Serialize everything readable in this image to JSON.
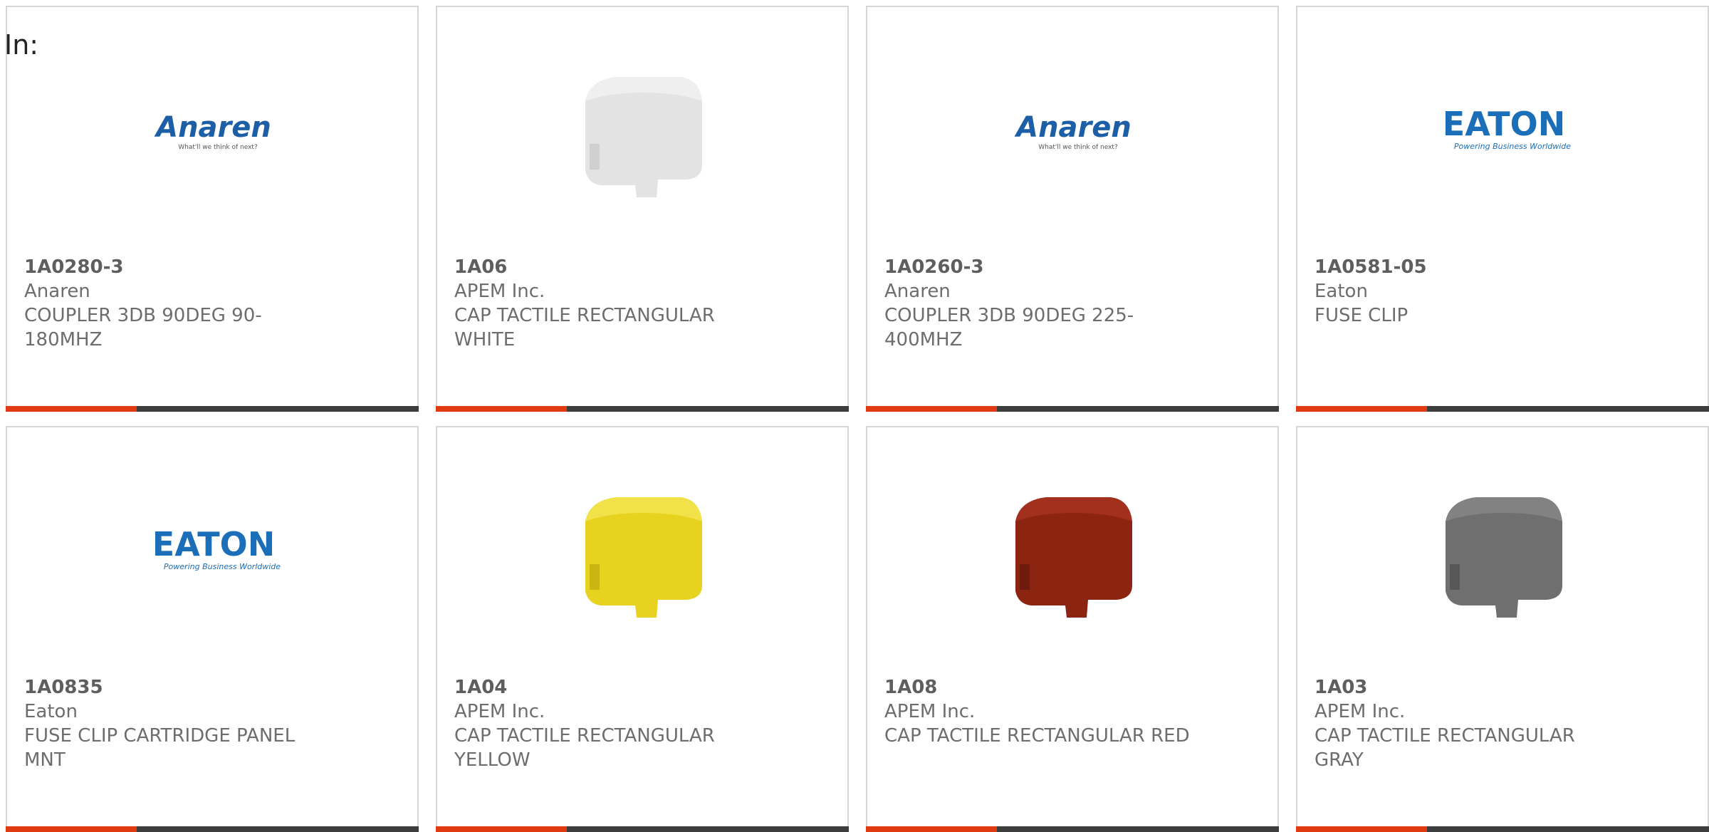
{
  "header": {
    "label": "In:"
  },
  "colors": {
    "accent": "#e03a13",
    "bar": "#3d3d3d",
    "border": "#d6d6d6",
    "text": "#6d6d6d",
    "anaren_blue": "#1c5fa6",
    "eaton_blue": "#1b6eb8"
  },
  "products": [
    {
      "part": "1A0280-3",
      "manufacturer": "Anaren",
      "description": "COUPLER 3DB 90DEG 90-180MHZ",
      "image": "anaren-logo",
      "logo_text": "Anaren",
      "logo_tagline": "What'll we think of next?"
    },
    {
      "part": "1A06",
      "manufacturer": "APEM Inc.",
      "description": "CAP TACTILE RECTANGULAR WHITE",
      "image": "cap-white"
    },
    {
      "part": "1A0260-3",
      "manufacturer": "Anaren",
      "description": "COUPLER 3DB 90DEG 225-400MHZ",
      "image": "anaren-logo",
      "logo_text": "Anaren",
      "logo_tagline": "What'll we think of next?"
    },
    {
      "part": "1A0581-05",
      "manufacturer": "Eaton",
      "description": "FUSE CLIP",
      "image": "eaton-logo",
      "logo_text": "EATON",
      "logo_tagline": "Powering Business Worldwide"
    },
    {
      "part": "1A0835",
      "manufacturer": "Eaton",
      "description": "FUSE CLIP CARTRIDGE PANEL MNT",
      "image": "eaton-logo",
      "logo_text": "EATON",
      "logo_tagline": "Powering Business Worldwide"
    },
    {
      "part": "1A04",
      "manufacturer": "APEM Inc.",
      "description": "CAP TACTILE RECTANGULAR YELLOW",
      "image": "cap-yellow"
    },
    {
      "part": "1A08",
      "manufacturer": "APEM Inc.",
      "description": "CAP TACTILE RECTANGULAR RED",
      "image": "cap-red"
    },
    {
      "part": "1A03",
      "manufacturer": "APEM Inc.",
      "description": "CAP TACTILE RECTANGULAR GRAY",
      "image": "cap-gray"
    }
  ]
}
